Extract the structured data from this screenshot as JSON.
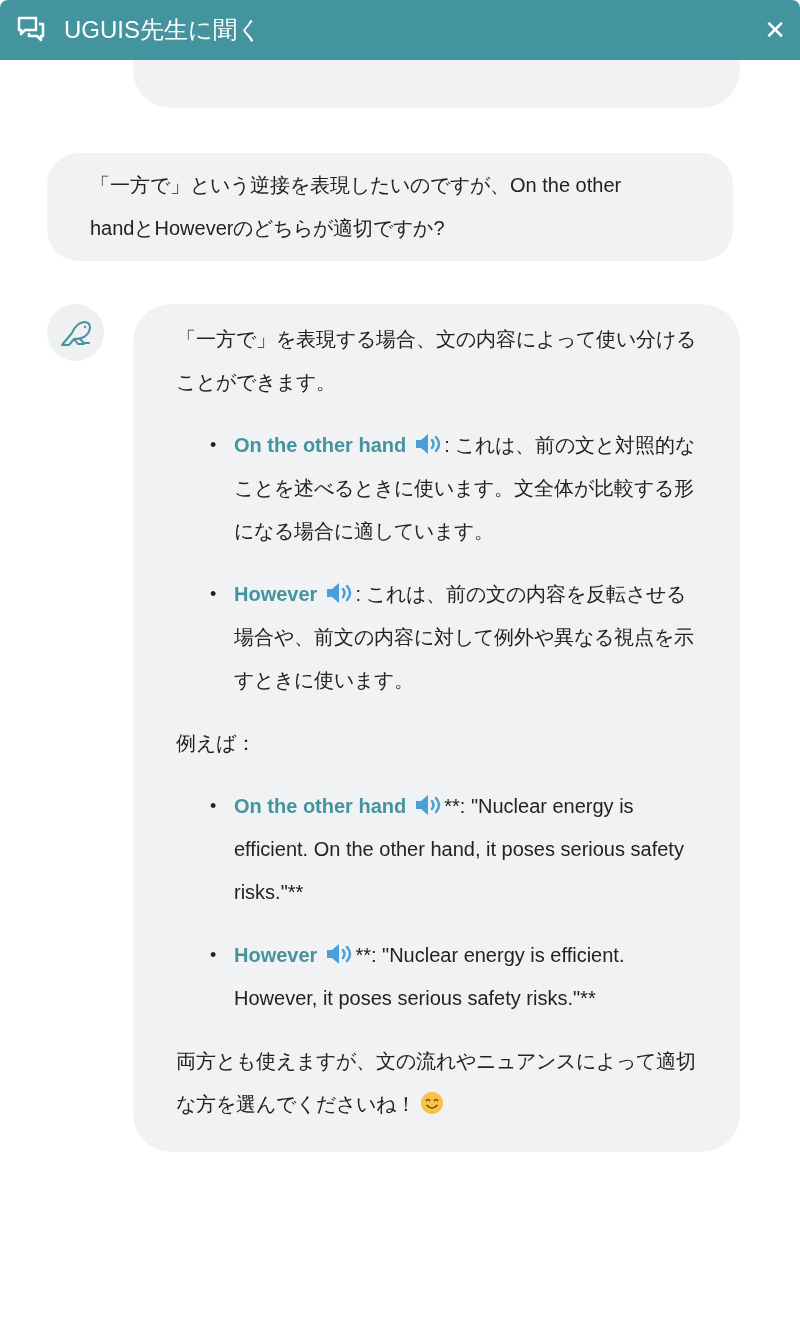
{
  "header": {
    "title": "UGUIS先生に聞く",
    "close": "✕"
  },
  "user_message": {
    "text": "「一方で」という逆接を表現したいのですが、On the other handとHoweverのどちらが適切ですか?"
  },
  "assistant_message": {
    "blocks": [
      {
        "kind": "paragraph",
        "text": "「一方で」を表現する場合、文の内容によって使い分けることができます。"
      },
      {
        "kind": "list",
        "items": [
          {
            "bullet": "•",
            "term": "On the other hand",
            "text": ": これは、前の文と対照的なことを述べるときに使います。文全体が比較する形になる場合に適しています。"
          },
          {
            "bullet": "•",
            "term": "However",
            "text": ": これは、前の文の内容を反転させる場合や、前文の内容に対して例外や異なる視点を示すときに使います。"
          }
        ]
      },
      {
        "kind": "paragraph",
        "text": "例えば："
      },
      {
        "kind": "list",
        "items": [
          {
            "bullet": "•",
            "term": "On the other hand",
            "text": "**: \"Nuclear energy is efficient. On the other hand, it poses serious safety risks.\"**"
          },
          {
            "bullet": "•",
            "term": "However",
            "text": "**: \"Nuclear energy is efficient. However, it poses serious safety risks.\"**"
          }
        ]
      },
      {
        "kind": "paragraph",
        "text": "両方とも使えますが、文の流れやニュアンスによって適切な方を選んでくださいね！",
        "emoji": true
      }
    ]
  }
}
